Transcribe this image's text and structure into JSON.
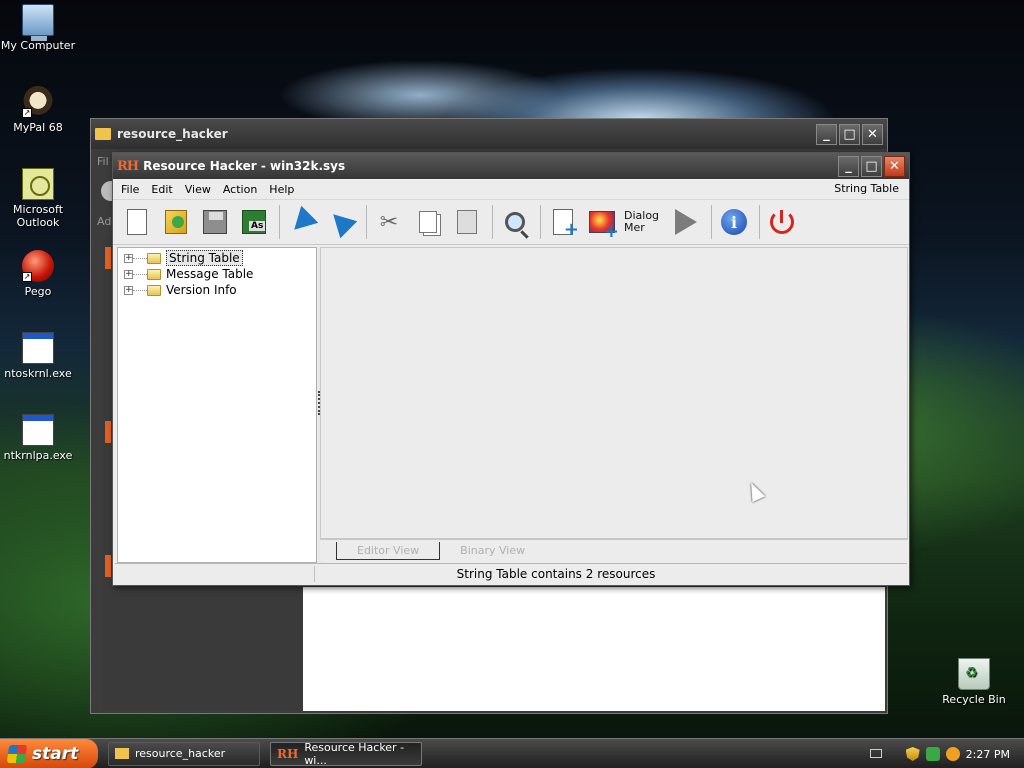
{
  "desktop": {
    "icons": [
      {
        "label": "My Computer"
      },
      {
        "label": "MyPal 68"
      },
      {
        "label": "Microsoft Outlook"
      },
      {
        "label": "Pego"
      },
      {
        "label": "ntoskrnl.exe"
      },
      {
        "label": "ntkrnlpa.exe"
      },
      {
        "label": "Recycle Bin"
      }
    ]
  },
  "bg_window": {
    "title": "resource_hacker",
    "partial_menu": "Fil",
    "partial_addr": "Ad"
  },
  "window": {
    "title": "Resource Hacker - win32k.sys",
    "logo": "RH",
    "controls": {
      "minimize": "_",
      "maximize": "□",
      "close": "✕"
    }
  },
  "menubar": {
    "items": [
      "File",
      "Edit",
      "View",
      "Action",
      "Help"
    ],
    "right_label": "String Table"
  },
  "toolbar": {
    "dialog_label_1": "Dialog",
    "dialog_label_2": "Mer"
  },
  "tree": {
    "items": [
      {
        "label": "String Table",
        "expander": "+"
      },
      {
        "label": "Message Table",
        "expander": "+"
      },
      {
        "label": "Version Info",
        "expander": "+"
      }
    ]
  },
  "view_tabs": {
    "editor": "Editor View",
    "binary": "Binary View"
  },
  "status": {
    "text": "String Table contains 2 resources"
  },
  "taskbar": {
    "start": "start",
    "tasks": [
      {
        "label": "resource_hacker"
      },
      {
        "label": "Resource Hacker - wi..."
      }
    ],
    "task_logo": "RH",
    "clock": "2:27 PM"
  },
  "colors": {
    "accent_orange": "#f06a2a",
    "start_orange": "#d4460b",
    "toolbar_blue": "#1e78c8",
    "power_red": "#d2271a"
  }
}
